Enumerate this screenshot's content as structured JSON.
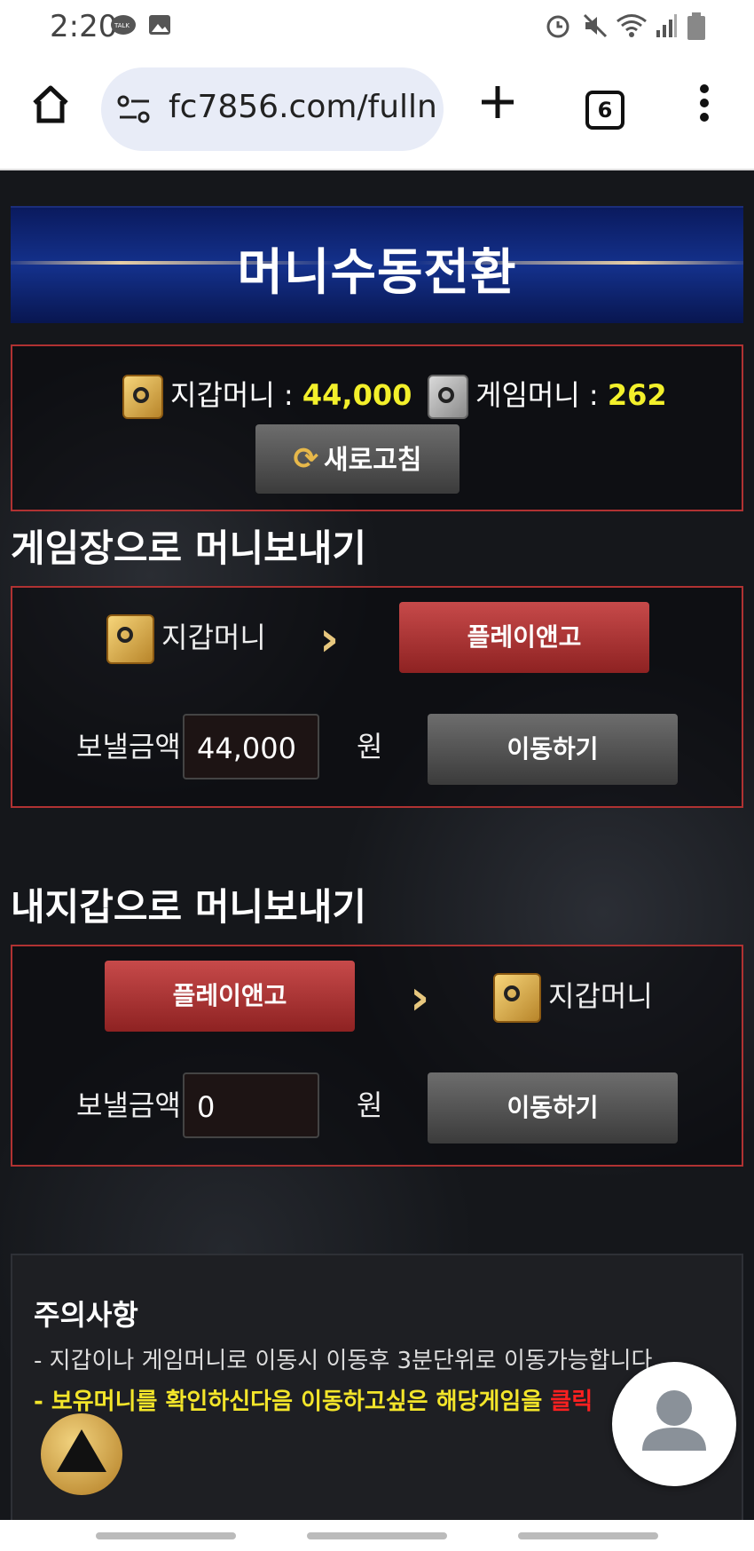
{
  "status_bar": {
    "time": "2:20",
    "icons": [
      "talk-icon",
      "image-icon",
      "alarm-icon",
      "mute-icon",
      "wifi-icon",
      "signal-icon",
      "battery-icon"
    ]
  },
  "browser": {
    "url": "fc7856.com/fulln",
    "tab_count": "6"
  },
  "banner": {
    "title": "머니수동전환"
  },
  "balance": {
    "wallet_label": "지갑머니 :",
    "wallet_value": "44,000",
    "game_label": "게임머니 :",
    "game_value": "262",
    "refresh_label": "새로고침"
  },
  "to_game": {
    "title": "게임장으로 머니보내기",
    "from_label": "지갑머니",
    "to_button": "플레이앤고",
    "amount_label": "보낼금액",
    "amount_value": "44,000",
    "unit": "원",
    "move_button": "이동하기"
  },
  "to_wallet": {
    "title": "내지갑으로 머니보내기",
    "from_button": "플레이앤고",
    "to_label": "지갑머니",
    "amount_label": "보낼금액",
    "amount_value": "0",
    "unit": "원",
    "move_button": "이동하기"
  },
  "notice": {
    "title": "주의사항",
    "line1": "- 지갑이나 게임머니로 이동시 이동후 3분단위로 이동가능합니다.",
    "line2_yellow": "- 보유머니를 확인하신다음 이동하고싶은 해당게임을 ",
    "line2_red": "클릭"
  },
  "colors": {
    "accent_yellow": "#f3f02b",
    "border_red": "#b03232",
    "button_red": "#b83a3a"
  }
}
